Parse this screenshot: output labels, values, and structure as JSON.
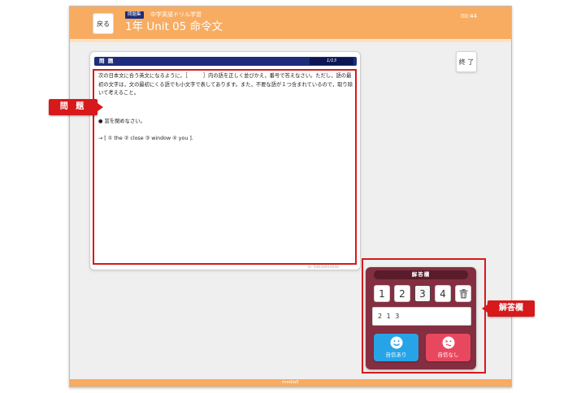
{
  "header": {
    "back_label": "戻る",
    "badge": "問題集",
    "set_name": "中学英語ドリル学習",
    "title": "1年 Unit 05 命令文",
    "timer": "00:44"
  },
  "end_label": "終 了",
  "question": {
    "header_label": "問 題",
    "counter": "1/13",
    "instruction": "次の日本文に合う英文になるように，［　　　］内の語を正しく並びかえ，番号で答えなさい。ただし，語の最初の文字は，文の最初にくる語でも小文字で表してあります。また，不要な語が１つ含まれているので，取り除いて考えること。",
    "prompt": "● 窓を閉めなさい。",
    "choices": "→ [ ① the ② close ③ window ④ you ].",
    "id": "id. S4630003040"
  },
  "answer": {
    "title": "解答欄",
    "numbers": [
      "1",
      "2",
      "3",
      "4"
    ],
    "selected_number": "3",
    "input_value": "2 1 3",
    "confident_label": "自信あり",
    "not_confident_label": "自信なし"
  },
  "footer": {
    "brand": "media5"
  },
  "annotations": {
    "question_label": "問 題",
    "answer_label": "解答欄"
  },
  "icons": {
    "trash": "trash-icon",
    "smile": "smile-icon",
    "confused": "confused-face-icon"
  },
  "colors": {
    "header": "#f7ac62",
    "question_header": "#1d2d7c",
    "answer_panel": "#842f41",
    "confident": "#27a4e7",
    "not_confident": "#e8485f",
    "annotation": "#d7191b"
  }
}
